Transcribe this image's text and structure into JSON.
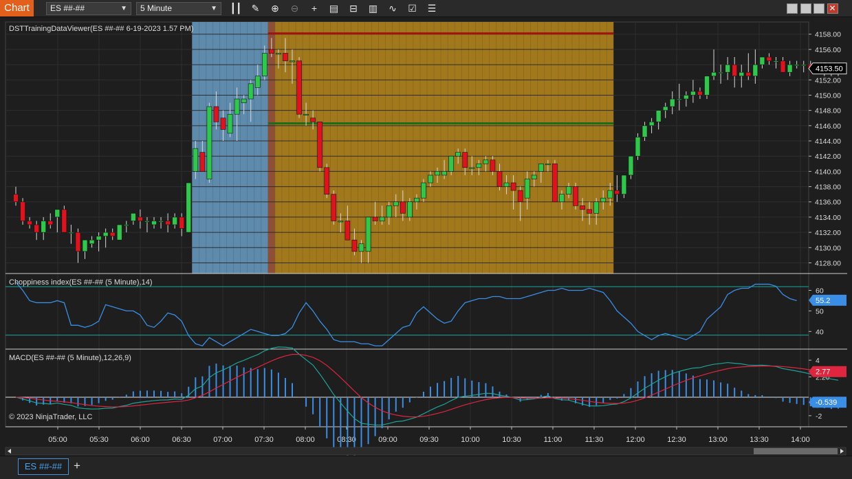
{
  "app_tab": "Chart",
  "toolbar": {
    "instrument": "ES ##-##",
    "interval": "5 Minute",
    "icons": [
      "bar-type-icon",
      "draw-pencil-icon",
      "zoom-in-icon",
      "zoom-out-icon",
      "crosshair-icon",
      "data-box-icon",
      "templates-icon",
      "strategies-icon",
      "indicators-icon",
      "properties-icon",
      "chart-trader-icon"
    ]
  },
  "window_buttons": [
    "restore-icon",
    "minimize-icon",
    "maximize-icon",
    "close-icon"
  ],
  "close_glyph": "✕",
  "colors": {
    "up": "#2ec84a",
    "down": "#e0121d",
    "session_blue": "#6a9ec6",
    "session_gold": "#b88a1c",
    "range_high": "#a31212",
    "range_low": "#1d6b1d",
    "choppiness": "#3a8ee6",
    "macd": "#1fa29a",
    "signal": "#e0253f",
    "histogram": "#3a8ee6"
  },
  "price_panel": {
    "label": "DSTTrainingDataViewer(ES ##-## 6-19-2023 1.57 PM)",
    "ticks": [
      "4158.00",
      "4156.00",
      "4154.00",
      "4152.00",
      "4150.00",
      "4148.00",
      "4146.00",
      "4144.00",
      "4142.00",
      "4140.00",
      "4138.00",
      "4136.00",
      "4134.00",
      "4132.00",
      "4130.00",
      "4128.00"
    ],
    "last_price": "4153.50"
  },
  "chop_panel": {
    "label": "Choppiness index(ES ##-## (5 Minute),14)",
    "ticks": [
      "60",
      "50",
      "40"
    ],
    "last_value": "55.2"
  },
  "macd_panel": {
    "label": "MACD(ES ##-## (5 Minute),12,26,9)",
    "ticks": [
      "4",
      "2.20",
      "-2"
    ],
    "macd_value": "2.77",
    "diff_value": "-0.539"
  },
  "copyright": "© 2023 NinjaTrader, LLC",
  "time_axis": [
    "05:00",
    "05:30",
    "06:00",
    "06:30",
    "07:00",
    "07:30",
    "08:00",
    "08:30",
    "09:00",
    "09:30",
    "10:00",
    "10:30",
    "11:00",
    "11:30",
    "12:00",
    "12:30",
    "13:00",
    "13:30",
    "14:00"
  ],
  "instrument_tab": "ES ##-##",
  "add_tab": "+",
  "chart_data": {
    "type": "candlestick",
    "price_ylim": [
      4126.6,
      4159.6
    ],
    "chop_ylim": [
      31.4,
      68.2
    ],
    "macd_ylim": [
      -3.2,
      5.2
    ],
    "grid": true,
    "shaded_ranges": [
      {
        "from_bar": 26,
        "to_bar": 36,
        "color": "session_blue"
      },
      {
        "from_bar": 37,
        "to_bar": 86,
        "color": "session_gold"
      }
    ],
    "range_lines": {
      "high": 4158.1,
      "low": 4146.3
    },
    "chop_levels": [
      61.8,
      38.2
    ],
    "candles": [
      [
        4137,
        4138,
        4135.5,
        4136
      ],
      [
        4136,
        4136.5,
        4133,
        4133.5
      ],
      [
        4133.5,
        4134,
        4132.5,
        4133
      ],
      [
        4133,
        4133.5,
        4131,
        4132
      ],
      [
        4132,
        4134,
        4131,
        4133.5
      ],
      [
        4133.5,
        4134.5,
        4132.5,
        4133
      ],
      [
        4134,
        4135,
        4132,
        4135
      ],
      [
        4135,
        4135.5,
        4132,
        4132
      ],
      [
        4132,
        4133,
        4130.5,
        4132
      ],
      [
        4132,
        4132.5,
        4128,
        4129.5
      ],
      [
        4129.5,
        4131,
        4128.5,
        4131
      ],
      [
        4130.5,
        4131.5,
        4130,
        4131
      ],
      [
        4131,
        4132,
        4129.5,
        4131.5
      ],
      [
        4131.5,
        4132.5,
        4130,
        4132
      ],
      [
        4132,
        4132.5,
        4131,
        4131.5
      ],
      [
        4131,
        4133,
        4131,
        4133
      ],
      [
        4133,
        4133.5,
        4132,
        4133
      ],
      [
        4133.5,
        4134.5,
        4133,
        4134.5
      ],
      [
        4134,
        4135,
        4132.5,
        4133.5
      ],
      [
        4133.5,
        4134,
        4132,
        4133.5
      ],
      [
        4133,
        4134,
        4132.5,
        4133.5
      ],
      [
        4133.5,
        4134,
        4132.5,
        4133.5
      ],
      [
        4133.5,
        4134.5,
        4132,
        4133
      ],
      [
        4133,
        4134.5,
        4132.5,
        4134
      ],
      [
        4134,
        4134.5,
        4131.5,
        4132.5
      ],
      [
        4132,
        4138.5,
        4132,
        4138.5
      ],
      [
        4140,
        4144,
        4139,
        4143
      ],
      [
        4142.5,
        4144,
        4140,
        4140
      ],
      [
        4139,
        4149,
        4138.5,
        4148.5
      ],
      [
        4148.5,
        4150.5,
        4145.5,
        4146.5
      ],
      [
        4147,
        4148,
        4144,
        4145.5
      ],
      [
        4145,
        4149,
        4144.5,
        4147.5
      ],
      [
        4147.5,
        4151,
        4144,
        4149.5
      ],
      [
        4149,
        4150,
        4147.5,
        4149.5
      ],
      [
        4149.5,
        4152,
        4146.5,
        4151.5
      ],
      [
        4151,
        4154,
        4150,
        4152.5
      ],
      [
        4152.5,
        4156.5,
        4152,
        4155.5
      ],
      [
        4156,
        4157.5,
        4155,
        4155.5
      ],
      [
        4155.5,
        4156,
        4153.5,
        4155.5
      ],
      [
        4155.5,
        4157.5,
        4153,
        4154.5
      ],
      [
        4154.5,
        4156,
        4151.5,
        4154.5
      ],
      [
        4154.5,
        4155,
        4147,
        4147.5
      ],
      [
        4147.5,
        4149,
        4146,
        4147.5
      ],
      [
        4147,
        4148,
        4145.5,
        4146.5
      ],
      [
        4146.5,
        4146.5,
        4140,
        4140.5
      ],
      [
        4140.5,
        4141,
        4136.5,
        4137
      ],
      [
        4137,
        4137.5,
        4133,
        4133.5
      ],
      [
        4133.5,
        4134.5,
        4132,
        4133.5
      ],
      [
        4133.5,
        4135.5,
        4131,
        4131
      ],
      [
        4131,
        4132.5,
        4129,
        4129.5
      ],
      [
        4129.5,
        4131,
        4128,
        4130.5
      ],
      [
        4129.5,
        4134,
        4128,
        4134
      ],
      [
        4134,
        4136,
        4133,
        4133.5
      ],
      [
        4133.5,
        4135.5,
        4133,
        4134
      ],
      [
        4134,
        4136,
        4133,
        4135.5
      ],
      [
        4135.5,
        4137,
        4134,
        4136
      ],
      [
        4136,
        4137.5,
        4133.5,
        4134.5
      ],
      [
        4134,
        4136.5,
        4133.5,
        4136
      ],
      [
        4136,
        4137,
        4135,
        4136.5
      ],
      [
        4136.5,
        4139,
        4136,
        4138.5
      ],
      [
        4138.5,
        4140,
        4138,
        4139.5
      ],
      [
        4139.5,
        4140.5,
        4138.5,
        4140
      ],
      [
        4139.5,
        4141.5,
        4139,
        4140
      ],
      [
        4140,
        4142,
        4139.5,
        4142
      ],
      [
        4142,
        4143,
        4141,
        4142.5
      ],
      [
        4142.5,
        4143,
        4139.5,
        4140.5
      ],
      [
        4140.5,
        4142,
        4139.5,
        4140.5
      ],
      [
        4140.5,
        4141.5,
        4139.5,
        4141
      ],
      [
        4141,
        4142,
        4140,
        4141.5
      ],
      [
        4141.5,
        4142,
        4139.5,
        4140
      ],
      [
        4140,
        4141,
        4137.5,
        4138
      ],
      [
        4138,
        4139.5,
        4137,
        4138.5
      ],
      [
        4138.5,
        4139.5,
        4135,
        4137.5
      ],
      [
        4137.5,
        4138,
        4133.5,
        4136
      ],
      [
        4136.5,
        4140,
        4135,
        4139
      ],
      [
        4139,
        4140,
        4138,
        4139.5
      ],
      [
        4140,
        4141,
        4138.5,
        4141
      ],
      [
        4141,
        4141.5,
        4140,
        4141
      ],
      [
        4141,
        4141.5,
        4136,
        4136
      ],
      [
        4136,
        4137.5,
        4135,
        4137
      ],
      [
        4137,
        4138.5,
        4136.5,
        4138
      ],
      [
        4138,
        4138.5,
        4135,
        4135.5
      ],
      [
        4135.5,
        4136.5,
        4133.5,
        4135
      ],
      [
        4135,
        4136,
        4133,
        4134.5
      ],
      [
        4134.5,
        4136.5,
        4133,
        4136
      ],
      [
        4136,
        4137.5,
        4135,
        4136.5
      ],
      [
        4136.5,
        4138.5,
        4135.5,
        4137.5
      ],
      [
        4137.5,
        4139.5,
        4136,
        4137
      ],
      [
        4137,
        4139.5,
        4136.5,
        4139.5
      ],
      [
        4139.5,
        4141.5,
        4139,
        4142
      ],
      [
        4142,
        4145,
        4141.5,
        4144.5
      ],
      [
        4144.5,
        4146.5,
        4144,
        4146
      ],
      [
        4146,
        4147,
        4145,
        4146.5
      ],
      [
        4146.5,
        4148,
        4145.5,
        4148
      ],
      [
        4148,
        4149,
        4147,
        4148.5
      ],
      [
        4148.5,
        4150.5,
        4147.5,
        4149.5
      ],
      [
        4149.5,
        4151.5,
        4148,
        4149.5
      ],
      [
        4149.5,
        4150.5,
        4148.5,
        4150
      ],
      [
        4150,
        4152,
        4149,
        4150.5
      ],
      [
        4150.5,
        4151,
        4149.5,
        4150
      ],
      [
        4150,
        4152.5,
        4149.5,
        4152.5
      ],
      [
        4152.5,
        4156,
        4152,
        4153
      ],
      [
        4153,
        4154,
        4151.5,
        4153
      ],
      [
        4153,
        4155,
        4152,
        4154
      ],
      [
        4154,
        4155,
        4151,
        4152.5
      ],
      [
        4152.5,
        4154,
        4151,
        4153
      ],
      [
        4153,
        4155.5,
        4152,
        4152.5
      ],
      [
        4152.5,
        4156,
        4151.5,
        4154
      ],
      [
        4154,
        4155,
        4153.5,
        4155
      ],
      [
        4155,
        4155.5,
        4154,
        4154.5
      ],
      [
        4154.5,
        4155,
        4153.5,
        4154.5
      ],
      [
        4154.5,
        4155,
        4153,
        4153
      ],
      [
        4153,
        4154.5,
        4152.5,
        4154
      ],
      [
        4154,
        4154.5,
        4153.5,
        4154
      ],
      [
        4154,
        4154.5,
        4153,
        4154
      ],
      [
        4154,
        4154.5,
        4153.5,
        4153.5
      ],
      [
        4153.5,
        4154,
        4153,
        4153
      ],
      [
        4153,
        4154,
        4152.5,
        4153.5
      ],
      [
        4153.5,
        4153.5,
        4152.5,
        4153
      ],
      [
        4153,
        4153.5,
        4152.5,
        4153.5
      ]
    ],
    "choppiness": [
      64,
      60,
      55,
      54,
      54,
      54,
      55,
      54,
      43,
      43,
      42,
      43,
      45,
      53,
      52,
      51,
      50,
      50,
      48,
      43,
      42,
      45,
      49,
      48,
      45,
      38,
      34,
      33,
      37,
      35,
      33,
      35,
      37,
      39,
      41,
      40,
      39,
      38,
      38,
      39,
      42,
      49,
      54,
      50,
      45,
      41,
      36,
      35,
      35,
      35,
      34,
      34,
      33,
      33,
      36,
      39,
      42,
      43,
      49,
      52,
      49,
      46,
      44,
      45,
      50,
      54,
      55,
      56,
      56,
      57,
      57,
      56,
      56,
      56,
      57,
      58,
      59,
      60,
      60,
      61,
      60,
      60,
      60,
      61,
      60,
      59,
      55,
      50,
      47,
      44,
      40,
      38,
      36,
      38,
      39,
      38,
      37,
      36,
      38,
      40,
      46,
      49,
      52,
      58,
      60,
      61,
      61,
      63,
      63,
      63,
      62,
      58,
      56,
      55
    ]
  }
}
